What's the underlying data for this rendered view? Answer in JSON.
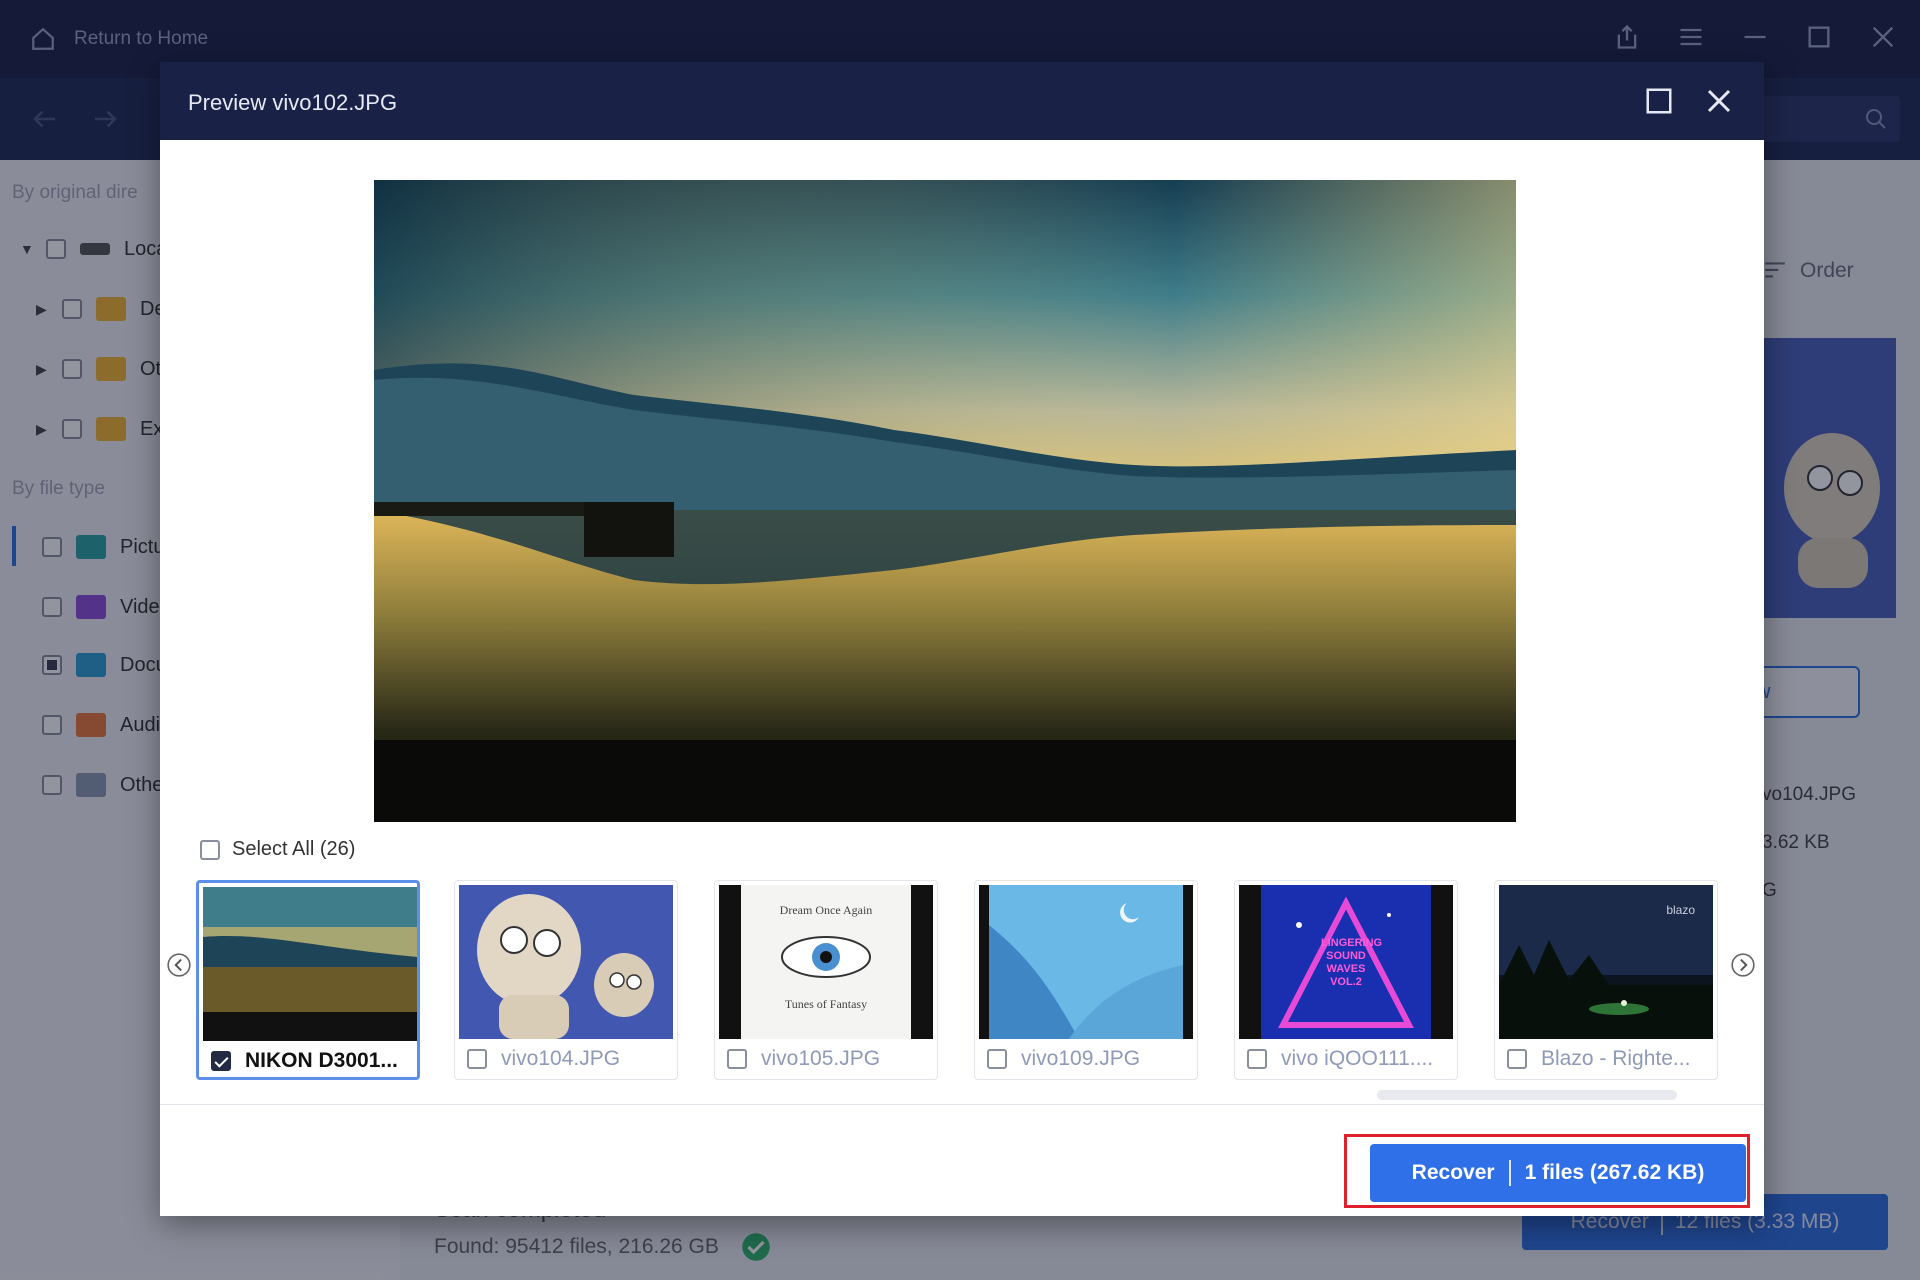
{
  "app": {
    "home_label": "Return to Home"
  },
  "sidebar": {
    "heading_directory": "By original dire",
    "heading_type": "By file type",
    "dir_items": [
      {
        "label": "Loca"
      },
      {
        "label": "De"
      },
      {
        "label": "Oth"
      },
      {
        "label": "Exi"
      }
    ],
    "type_items": [
      {
        "label": "Pictu",
        "color": "#2aa3a3"
      },
      {
        "label": "Vide",
        "color": "#8a4fd6"
      },
      {
        "label": "Docu",
        "color": "#2f9fd3"
      },
      {
        "label": "Audi",
        "color": "#e8783a"
      },
      {
        "label": "Othe",
        "color": "#8a9ab0"
      }
    ]
  },
  "main": {
    "order_label": "Order",
    "preview_btn_fragment": "w",
    "info_lines": [
      "vo104.JPG",
      "3.62 KB",
      "G"
    ],
    "scan_title": "Scan completed",
    "scan_found": "Found: 95412 files, 216.26 GB",
    "recover_label": "Recover",
    "recover_count": "12 files (3.33 MB)"
  },
  "modal": {
    "title": "Preview vivo102.JPG",
    "select_all": "Select All (26)",
    "thumbnails": [
      {
        "label": "NIKON D3001...",
        "checked": true
      },
      {
        "label": "vivo104.JPG",
        "checked": false
      },
      {
        "label": "vivo105.JPG",
        "checked": false
      },
      {
        "label": "vivo109.JPG",
        "checked": false
      },
      {
        "label": "vivo iQOO111....",
        "checked": false
      },
      {
        "label": "Blazo - Righte...",
        "checked": false
      }
    ],
    "album_text": {
      "dream_title": "Dream Once Again",
      "dream_sub": "Tunes of Fantasy",
      "lingering": "LINGERING SOUND WAVES VOL.2",
      "blazo": "blazo"
    },
    "recover_label": "Recover",
    "recover_count": "1 files (267.62 KB)"
  },
  "colors": {
    "accent": "#2f6fe8",
    "highlight": "#e0202a",
    "header": "#1a2146",
    "success": "#2fb56a"
  }
}
